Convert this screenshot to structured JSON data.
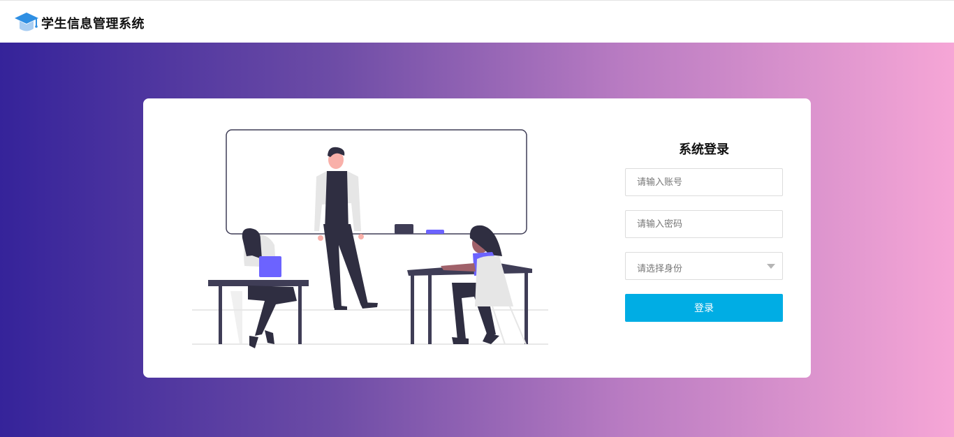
{
  "header": {
    "title": "学生信息管理系统",
    "logo_icon": "graduation-cap-icon"
  },
  "login": {
    "title": "系统登录",
    "username_placeholder": "请输入账号",
    "password_placeholder": "请输入密码",
    "role_placeholder": "请选择身份",
    "submit_label": "登录"
  },
  "colors": {
    "accent": "#00ade4",
    "gradient_start": "#35239a",
    "gradient_end": "#f6a6d6",
    "illustration_accent": "#6c63ff",
    "illustration_dark": "#2f2e41"
  }
}
